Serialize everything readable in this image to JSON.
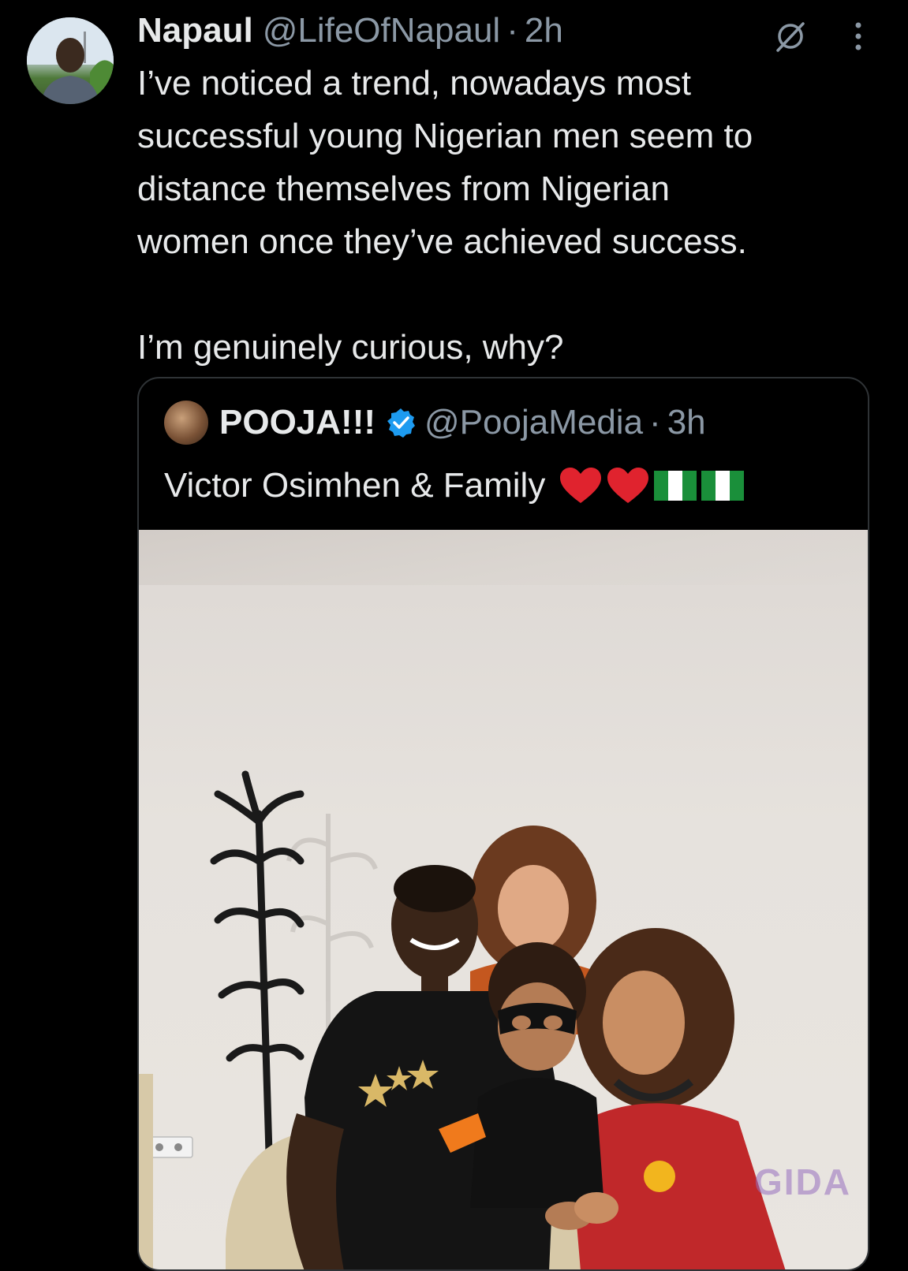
{
  "tweet": {
    "author_name": "Napaul",
    "author_handle": "@LifeOfNapaul",
    "separator": "·",
    "time": "2h",
    "text_p1": "I’ve noticed a trend, nowadays most\nsuccessful young Nigerian men seem to\ndistance themselves from Nigerian\nwomen once they’ve achieved success.",
    "text_p2": "I’m genuinely curious, why?"
  },
  "quoted": {
    "author_name": "POOJA!!!",
    "author_handle": "@PoojaMedia",
    "separator": "·",
    "time": "3h",
    "text": "Victor Osimhen & Family",
    "emojis": [
      "red-heart",
      "red-heart",
      "nigeria-flag",
      "nigeria-flag"
    ],
    "media_watermark": "GIDA"
  },
  "icons": {
    "grok": "grok-icon",
    "more": "more-vertical-icon",
    "verified": "verified-badge-icon"
  },
  "colors": {
    "background": "#000000",
    "text_primary": "#e7e9ea",
    "text_secondary": "#8b98a5",
    "border": "#2f3336",
    "verified_blue": "#1d9bf0"
  }
}
